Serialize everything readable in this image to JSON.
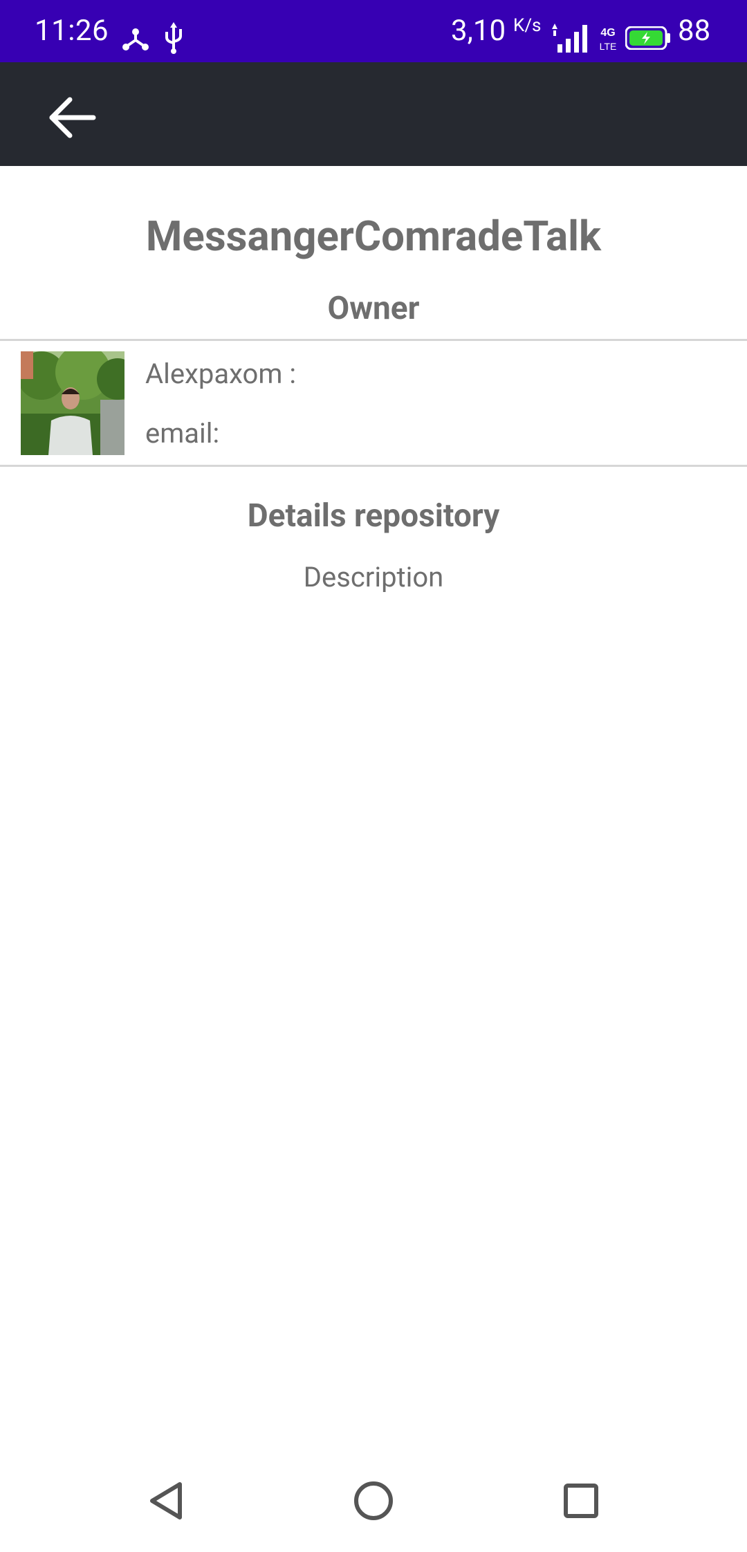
{
  "status_bar": {
    "time": "11:26",
    "net_speed": "3,10",
    "net_unit": "K/s",
    "battery_level": "88",
    "icons": [
      "usb-debug-icon",
      "usb-icon",
      "signal-icon",
      "lte-icon",
      "battery-charging-icon"
    ],
    "network_label": "4G LTE",
    "bg_color": "#3700b3"
  },
  "app_bar": {
    "bg_color": "#262930",
    "back_icon": "arrow-back-icon"
  },
  "repository": {
    "name": "MessangerComradeTalk",
    "owner_heading": "Owner",
    "owner_login": "Alexpaxom :",
    "owner_email_label": "email:",
    "details_heading": "Details repository",
    "description": "Description"
  },
  "nav_bar": {
    "icons": [
      "nav-back-icon",
      "nav-home-icon",
      "nav-recents-icon"
    ]
  },
  "colors": {
    "text_gray": "#6e6e6e",
    "divider": "#d6d6d6"
  }
}
